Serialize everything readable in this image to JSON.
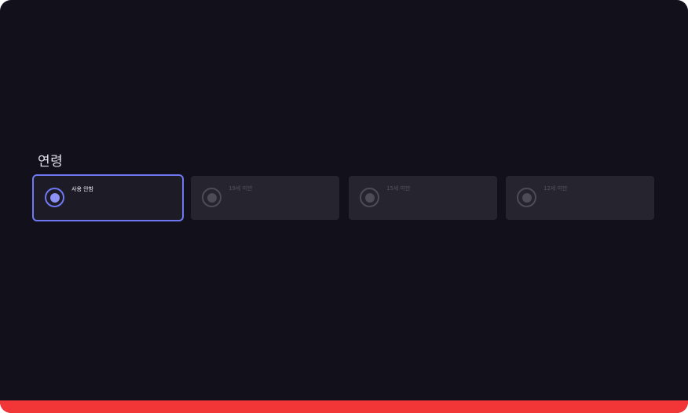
{
  "section": {
    "title": "연령"
  },
  "age_options": [
    {
      "label": "사용 안함",
      "selected": true
    },
    {
      "label": "19세 미만",
      "selected": false
    },
    {
      "label": "15세 미만",
      "selected": false
    },
    {
      "label": "12세 미만",
      "selected": false
    }
  ],
  "colors": {
    "background": "#11101b",
    "accent": "#6f77f2",
    "option_background": "#25242f",
    "bottom_bar": "#f23536"
  }
}
